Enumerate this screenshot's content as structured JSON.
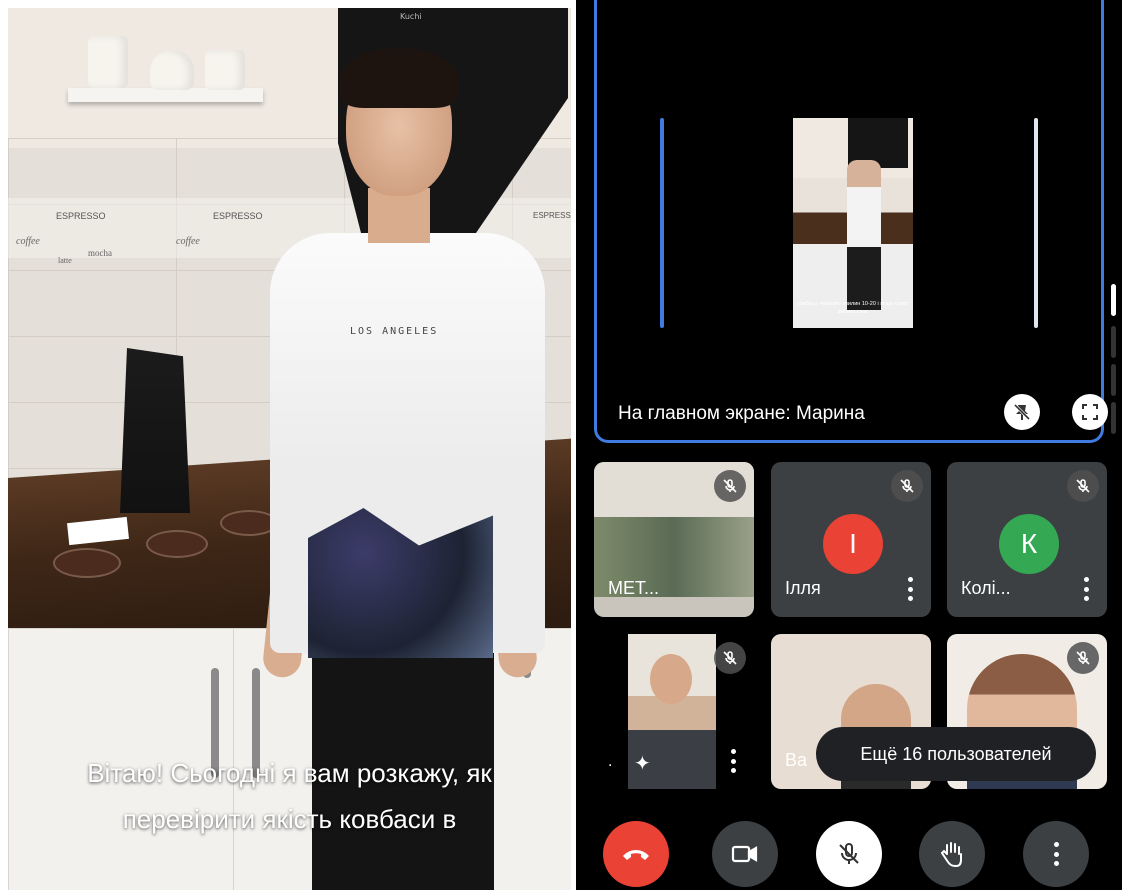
{
  "left_video": {
    "shirt_text": "LOS ANGELES",
    "caption_line1": "Вітаю! Сьогодні я вам розкажу, як",
    "caption_line2": "перевірити якість ковбаси в",
    "hood_brand": "Kuchi",
    "tiles_words": [
      "ESPRESSO",
      "coffee",
      "mocha",
      "latte",
      "ESPRESSO",
      "coffee",
      "ESPRESSO"
    ]
  },
  "meeting": {
    "spotlight": {
      "label": "На главном экране: Марина",
      "inner_caption": "ковбасу, чекаємо хвилин 10-20 і якщо спирт змінює своє",
      "unpin_icon": "unpin-icon",
      "fullscreen_icon": "fullscreen-icon"
    },
    "tiles": [
      {
        "name": "МЕТ...",
        "muted": true,
        "type": "video"
      },
      {
        "name": "Ілля",
        "initial": "І",
        "avatar_color": "#ea4335",
        "muted": true,
        "type": "avatar"
      },
      {
        "name": "Колі...",
        "initial": "К",
        "avatar_color": "#34a853",
        "muted": true,
        "type": "avatar"
      },
      {
        "name": ".",
        "muted": true,
        "type": "video"
      },
      {
        "name": "Ва",
        "muted": false,
        "type": "video"
      },
      {
        "name": "",
        "muted": true,
        "type": "video"
      }
    ],
    "more_users": "Ещё 16 пользователей",
    "controls": [
      {
        "name": "end-call",
        "icon": "phone-hangup-icon",
        "color": "#ea4335"
      },
      {
        "name": "camera",
        "icon": "video-camera-icon",
        "color": "#3c4043"
      },
      {
        "name": "mic",
        "icon": "mic-off-icon",
        "color": "#ffffff"
      },
      {
        "name": "raise-hand",
        "icon": "hand-icon",
        "color": "#3c4043"
      },
      {
        "name": "more-options",
        "icon": "more-vert-icon",
        "color": "#3c4043"
      }
    ],
    "accent": "#3f7be0"
  }
}
